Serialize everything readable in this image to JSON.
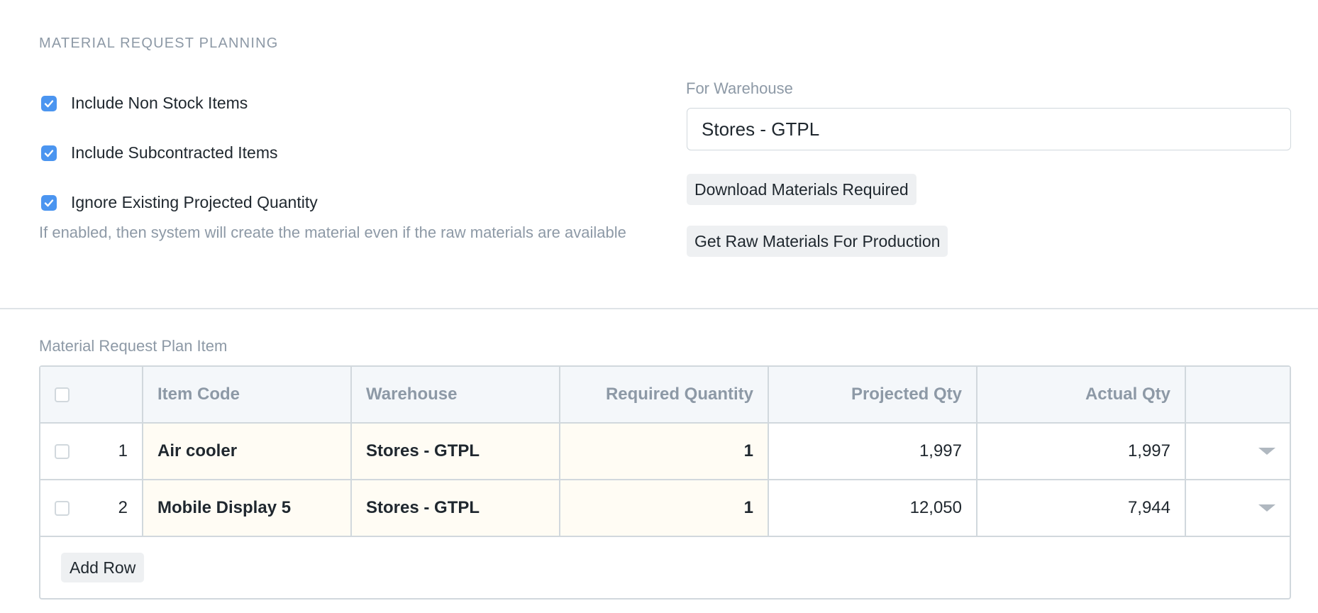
{
  "section": {
    "title": "MATERIAL REQUEST PLANNING"
  },
  "options": [
    {
      "label": "Include Non Stock Items",
      "checked": true
    },
    {
      "label": "Include Subcontracted Items",
      "checked": true
    },
    {
      "label": "Ignore Existing Projected Quantity",
      "checked": true
    }
  ],
  "help_text": "If enabled, then system will create the material even if the raw materials are available",
  "warehouse_field": {
    "label": "For Warehouse",
    "value": "Stores - GTPL"
  },
  "buttons": {
    "download": "Download Materials Required",
    "get_raw": "Get Raw Materials For Production"
  },
  "table": {
    "label": "Material Request Plan Item",
    "headers": {
      "item_code": "Item Code",
      "warehouse": "Warehouse",
      "required_qty": "Required Quantity",
      "projected_qty": "Projected Qty",
      "actual_qty": "Actual Qty"
    },
    "rows": [
      {
        "idx": "1",
        "item_code": "Air cooler",
        "warehouse": "Stores - GTPL",
        "required_qty": "1",
        "projected_qty": "1,997",
        "actual_qty": "1,997"
      },
      {
        "idx": "2",
        "item_code": "Mobile Display 5",
        "warehouse": "Stores - GTPL",
        "required_qty": "1",
        "projected_qty": "12,050",
        "actual_qty": "7,944"
      }
    ],
    "add_row_label": "Add Row"
  },
  "colors": {
    "accent": "#4b95f0",
    "muted_text": "#8d99a6",
    "editable_cell": "#fffcf4"
  }
}
